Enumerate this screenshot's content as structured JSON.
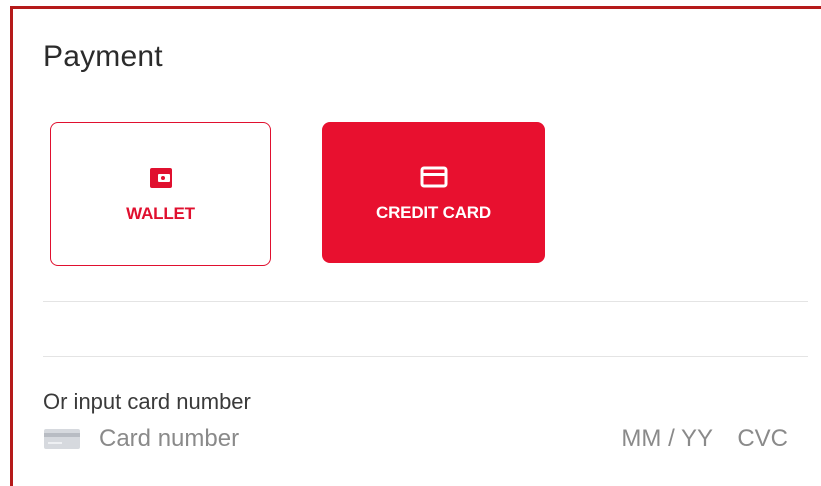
{
  "payment": {
    "title": "Payment",
    "methods": [
      {
        "label": "WALLET",
        "icon": "wallet-icon",
        "selected": false
      },
      {
        "label": "CREDIT CARD",
        "icon": "credit-card-icon",
        "selected": true
      }
    ]
  },
  "card_entry": {
    "prompt": "Or input card number",
    "card_number_placeholder": "Card number",
    "expiry_placeholder": "MM / YY",
    "cvc_placeholder": "CVC"
  },
  "colors": {
    "accent": "#e8102f",
    "border": "#b51a1a",
    "divider": "#e4e4e4"
  }
}
